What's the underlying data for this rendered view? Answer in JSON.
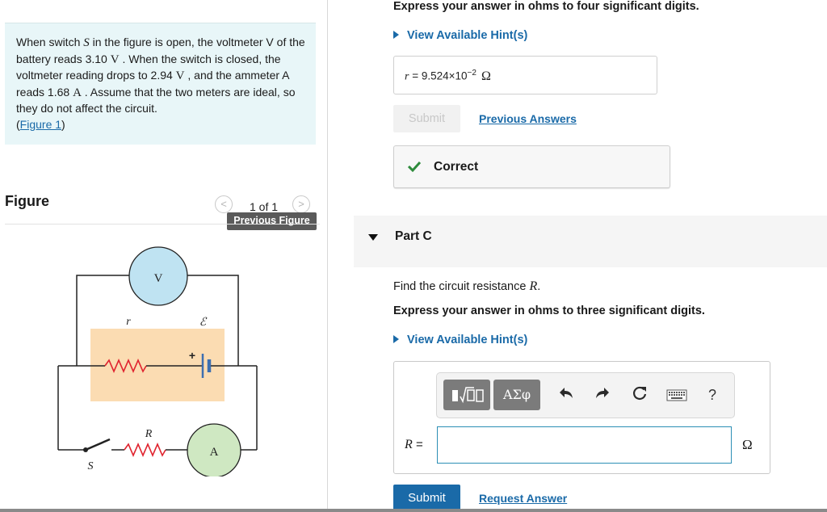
{
  "problem": {
    "text_1": "When switch ",
    "var_S": "S",
    "text_2": " in the figure is open, the voltmeter V of the battery reads 3.10 ",
    "unit_V1": "V",
    "text_3": " . When the switch is closed, the voltmeter reading drops to 2.94 ",
    "unit_V2": "V",
    "text_4": " , and the ammeter A reads 1.68 ",
    "unit_A": "A",
    "text_5": " . Assume that the two meters are ideal, so they do not affect the circuit.",
    "link_open": "(",
    "link_text": "Figure 1",
    "link_close": ")"
  },
  "figure": {
    "heading": "Figure",
    "prev_arrow": "<",
    "next_arrow": ">",
    "counter": "1 of 1",
    "tooltip": "Previous Figure",
    "labels": {
      "voltmeter": "V",
      "internal_r": "r",
      "emf": "ℰ",
      "plus": "+",
      "resistor": "R",
      "ammeter": "A",
      "switch": "S"
    }
  },
  "part_b": {
    "instruction": "Express your answer in ohms to four significant digits.",
    "hint": "View Available Hint(s)",
    "answer_var": "r",
    "answer_eq": " = ",
    "answer_mantissa": "9.524×10",
    "answer_exp": "−2",
    "answer_unit": "Ω",
    "submit": "Submit",
    "previous_answers": "Previous Answers",
    "status": "Correct",
    "status_color": "#2e8b3c"
  },
  "part_c": {
    "title": "Part C",
    "question_prefix": "Find the circuit resistance ",
    "question_var": "R",
    "question_suffix": ".",
    "instruction": "Express your answer in ohms to three significant digits.",
    "hint": "View Available Hint(s)",
    "toolbar": {
      "greek": "ΑΣφ",
      "icons": [
        "templates-icon",
        "greek-symbols-icon",
        "undo-icon",
        "redo-icon",
        "reset-icon",
        "keyboard-icon",
        "help-icon"
      ],
      "help": "?"
    },
    "lhs_var": "R",
    "lhs_eq": " =",
    "input_value": "",
    "unit": "Ω",
    "submit": "Submit",
    "request_answer": "Request Answer"
  },
  "colors": {
    "accent": "#1a6aa8",
    "problem_bg": "#e8f6f8",
    "input_border": "#2c8fb5",
    "voltmeter_fill": "#bfe3f2",
    "ammeter_fill": "#cfe8c2",
    "battery_box": "#fbdcb2",
    "resistor_red": "#e0242f"
  }
}
